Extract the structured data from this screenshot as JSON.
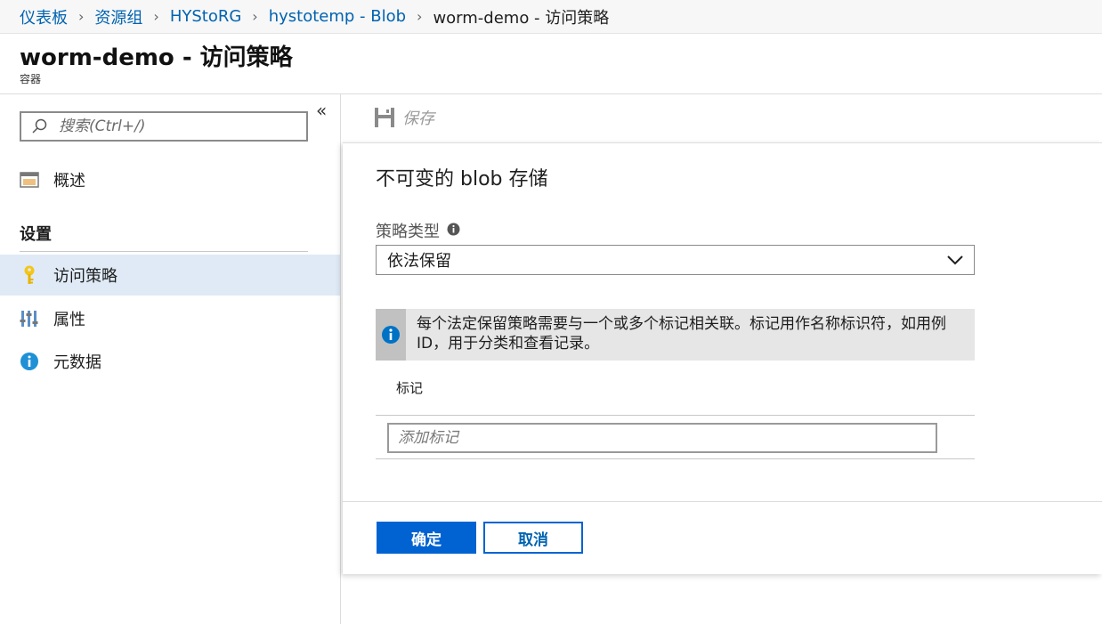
{
  "breadcrumb": {
    "items": [
      "仪表板",
      "资源组",
      "HYStoRG",
      "hystotemp - Blob"
    ],
    "current": "worm-demo - 访问策略",
    "separator": "›"
  },
  "header": {
    "title": "worm-demo - 访问策略",
    "subtitle": "容器"
  },
  "sidebar": {
    "collapse_label": "«",
    "search_placeholder": "搜索(Ctrl+/)",
    "items": [
      {
        "label": "概述",
        "icon": "overview-icon"
      },
      {
        "label": "访问策略",
        "icon": "key-icon",
        "selected": true
      },
      {
        "label": "属性",
        "icon": "properties-icon"
      },
      {
        "label": "元数据",
        "icon": "info-icon"
      }
    ],
    "section_header": "设置"
  },
  "toolbar": {
    "save_label": "保存",
    "save_icon": "save-icon"
  },
  "panel": {
    "title": "不可变的 blob 存储",
    "policy_type_label": "策略类型",
    "policy_type_value": "依法保留",
    "info_message": "每个法定保留策略需要与一个或多个标记相关联。标记用作名称标识符，如用例 ID，用于分类和查看记录。",
    "tags_header": "标记",
    "tag_placeholder": "添加标记",
    "ok_label": "确定",
    "cancel_label": "取消"
  },
  "colors": {
    "link": "#0063b1",
    "primary_button": "#0063d1",
    "selected_nav": "#dfeaf6",
    "info_blue": "#0072c6"
  }
}
